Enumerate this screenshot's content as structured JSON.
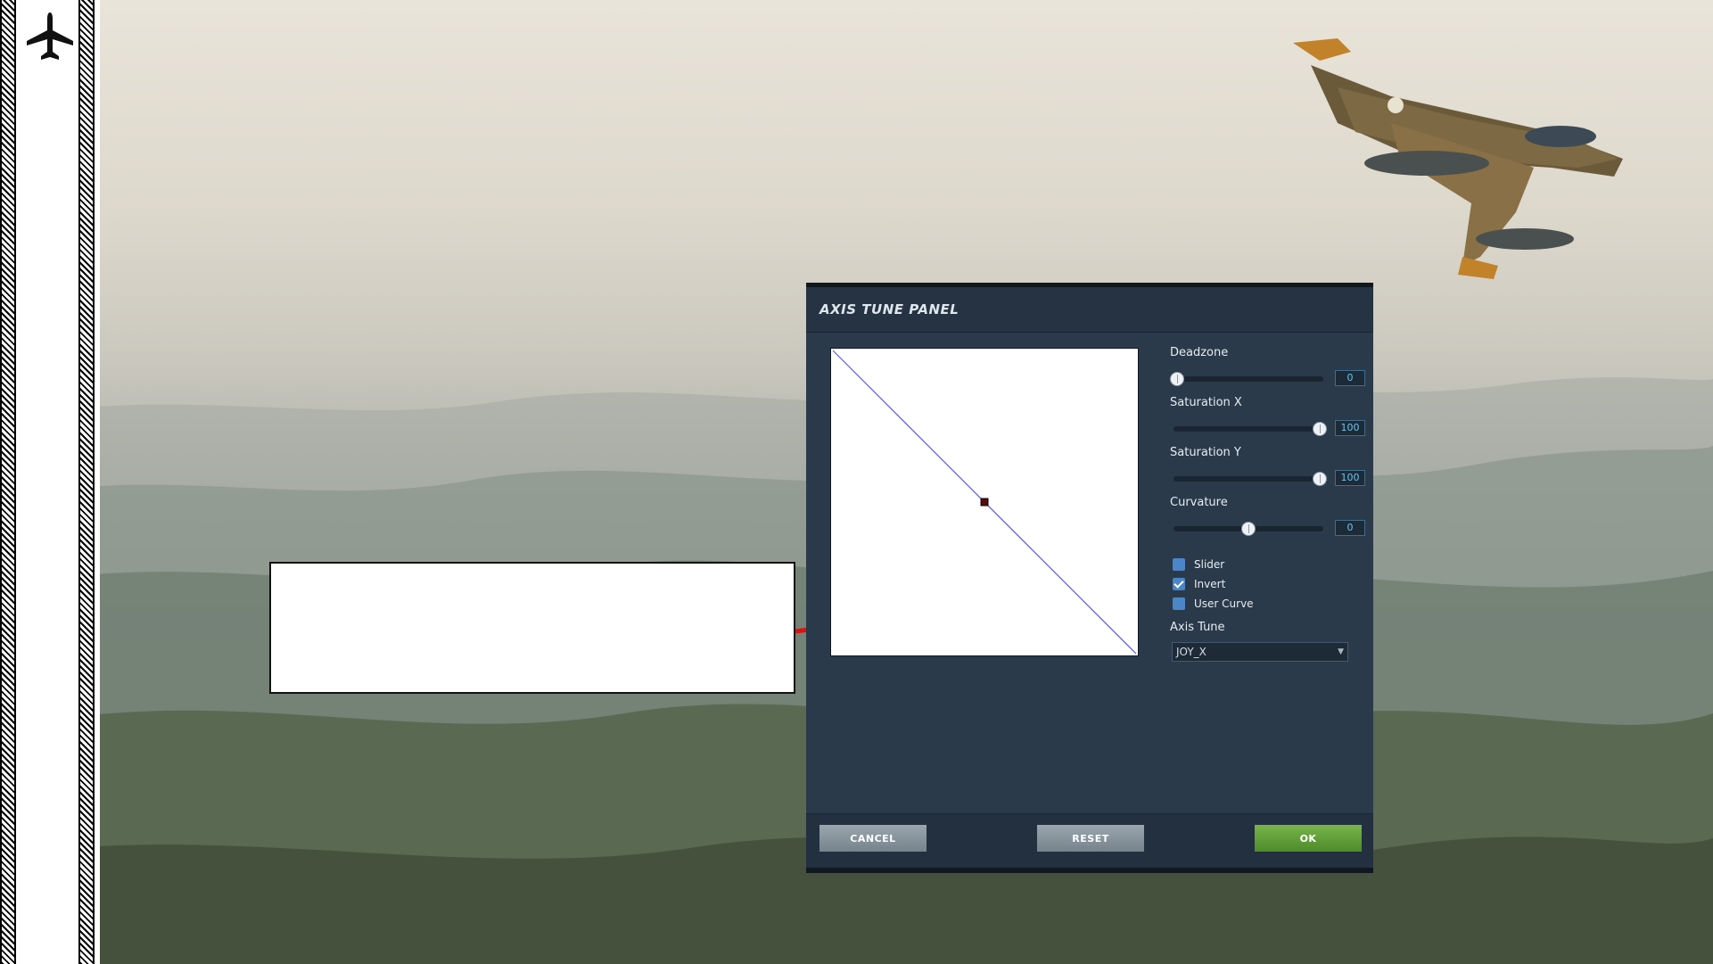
{
  "panel": {
    "title": "AXIS TUNE PANEL",
    "deadzone": {
      "label": "Deadzone",
      "value": "0",
      "level": 0
    },
    "saturation_x": {
      "label": "Saturation X",
      "value": "100",
      "level": 1
    },
    "saturation_y": {
      "label": "Saturation Y",
      "value": "100",
      "level": 1
    },
    "curvature": {
      "label": "Curvature",
      "value": "0",
      "level": 0.5
    },
    "checkboxes": [
      {
        "label": "Slider",
        "checked": false
      },
      {
        "label": "Invert",
        "checked": true
      },
      {
        "label": "User Curve",
        "checked": false
      }
    ],
    "axis_tune": {
      "label": "Axis Tune",
      "selected": "JOY_X"
    },
    "buttons": {
      "cancel": "CANCEL",
      "reset": "RESET",
      "ok": "OK"
    }
  },
  "icons": {
    "rail": "airplane-icon",
    "jet": "fighter-jet-illustration"
  },
  "colors": {
    "panel_bg": "#2b3a4a",
    "ok_green": "#5e9e38",
    "arrow_red": "#e01010",
    "value_text": "#6cc4ee",
    "checkbox_blue": "#4b86c8"
  }
}
